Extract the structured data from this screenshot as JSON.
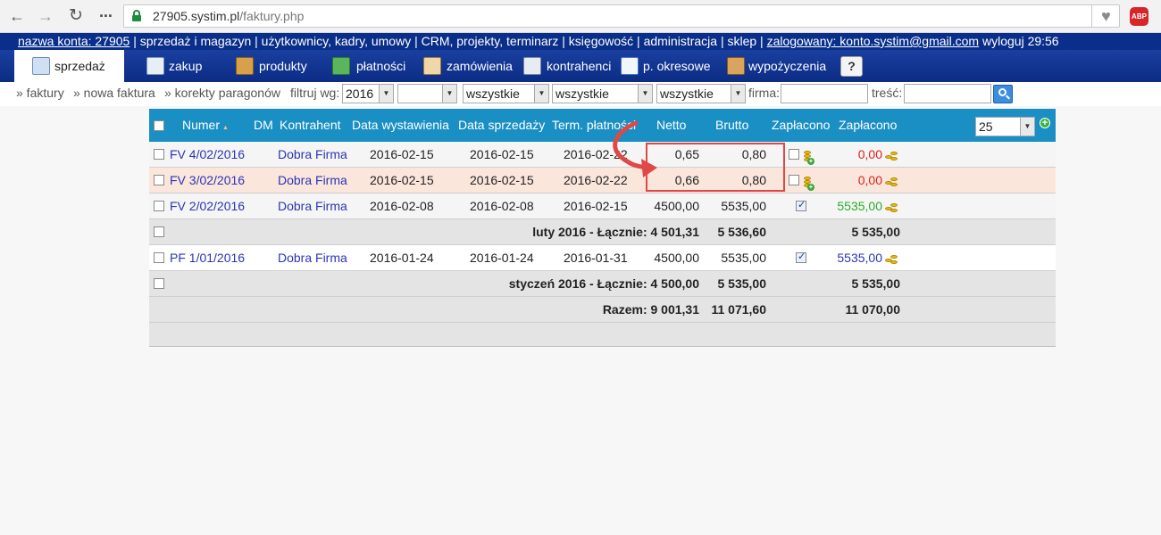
{
  "browser": {
    "url_host": "27905.systim.pl",
    "url_path": "/faktury.php",
    "adblock_label": "ABP"
  },
  "account_bar": {
    "account": "nazwa konta: 27905",
    "links": " | sprzedaż i magazyn | użytkownicy, kadry, umowy | CRM, projekty, terminarz | księgowość | administracja | sklep | ",
    "logged_in": "zalogowany: konto.systim@gmail.com",
    "logout": " wyloguj 29:56"
  },
  "menu": {
    "items": [
      {
        "label": "sprzedaż"
      },
      {
        "label": "zakup"
      },
      {
        "label": "produkty"
      },
      {
        "label": "płatności"
      },
      {
        "label": "zamówienia"
      },
      {
        "label": "kontrahenci"
      },
      {
        "label": "p. okresowe"
      },
      {
        "label": "wypożyczenia"
      },
      {
        "label": "?"
      }
    ]
  },
  "subbar": {
    "links": [
      "» faktury",
      "» nowa faktura",
      "» korekty paragonów"
    ],
    "filter_label": "filtruj wg:",
    "year": "2016",
    "month": "",
    "status1": "wszystkie",
    "status2": "wszystkie",
    "status3": "wszystkie",
    "firma_label": "firma:",
    "tresc_label": "treść:"
  },
  "table": {
    "headers": {
      "numer": "Numer",
      "sort_glyph": "▲",
      "dm": "DM",
      "kontrahent": "Kontrahent",
      "data_wystawienia": "Data wystawienia",
      "data_sprzedazy": "Data sprzedaży",
      "term_platnosci": "Term. płatności",
      "netto": "Netto",
      "brutto": "Brutto",
      "zaplacono1": "Zapłacono",
      "zaplacono2": "Zapłacono",
      "per_page": "25",
      "add_glyph": "+"
    },
    "rows": [
      {
        "numer": "FV 4/02/2016",
        "kontrahent": "Dobra Firma",
        "wyst": "2016-02-15",
        "sprz": "2016-02-15",
        "term": "2016-02-22",
        "netto": "0,65",
        "brutto": "0,80",
        "paid": "0,00"
      },
      {
        "numer": "FV 3/02/2016",
        "kontrahent": "Dobra Firma",
        "wyst": "2016-02-15",
        "sprz": "2016-02-15",
        "term": "2016-02-22",
        "netto": "0,66",
        "brutto": "0,80",
        "paid": "0,00"
      },
      {
        "numer": "FV 2/02/2016",
        "kontrahent": "Dobra Firma",
        "wyst": "2016-02-08",
        "sprz": "2016-02-08",
        "term": "2016-02-15",
        "netto": "4500,00",
        "brutto": "5535,00",
        "paid": "5535,00"
      },
      {
        "summary": "luty 2016 - Łącznie: 4 501,31",
        "brutto": "5 536,60",
        "paid": "5 535,00"
      },
      {
        "numer": "PF 1/01/2016",
        "kontrahent": "Dobra Firma",
        "wyst": "2016-01-24",
        "sprz": "2016-01-24",
        "term": "2016-01-31",
        "netto": "4500,00",
        "brutto": "5535,00",
        "paid": "5535,00"
      },
      {
        "summary": "styczeń 2016 - Łącznie: 4 500,00",
        "brutto": "5 535,00",
        "paid": "5 535,00"
      },
      {
        "summary": "Razem: 9 001,31",
        "brutto": "11 071,60",
        "paid": "11 070,00"
      }
    ]
  },
  "colors": {
    "account_bar": "#0a2f8a",
    "table_header": "#1a8fc4",
    "link": "#2a35b5",
    "unpaid": "#e0201a",
    "paid_green": "#2bad2b",
    "highlight_row": "#fbe6dc",
    "annotation_red": "#e04848"
  }
}
